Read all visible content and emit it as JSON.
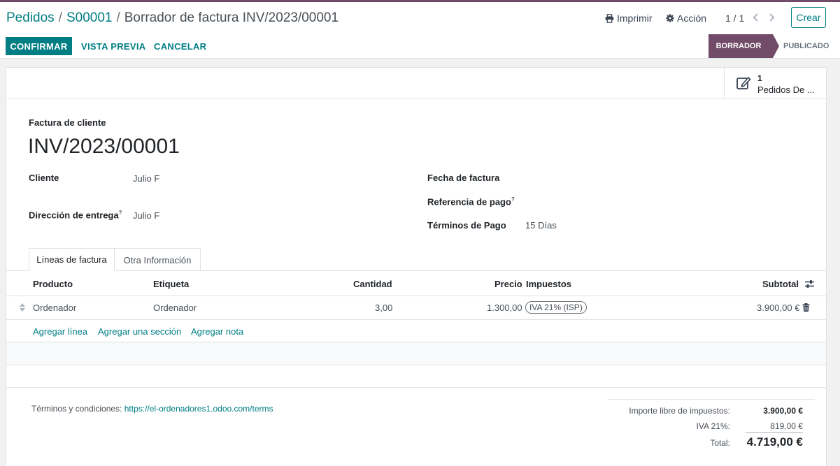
{
  "breadcrumb": {
    "root": "Pedidos",
    "order": "S00001",
    "current": "Borrador de factura INV/2023/00001"
  },
  "toolbar": {
    "print": "Imprimir",
    "action": "Acción",
    "pager": "1 / 1",
    "create": "Crear"
  },
  "statusbar": {
    "confirm": "CONFIRMAR",
    "preview": "VISTA PREVIA",
    "cancel": "CANCELAR",
    "stages": [
      "BORRADOR",
      "PUBLICADO"
    ],
    "active_stage": "BORRADOR"
  },
  "smart_button": {
    "value": "1",
    "label": "Pedidos De ..."
  },
  "form": {
    "type_label": "Factura de cliente",
    "number": "INV/2023/00001",
    "customer_label": "Cliente",
    "customer": "Julio F",
    "delivery_label": "Dirección de entrega",
    "delivery": "Julio F",
    "invoice_date_label": "Fecha de factura",
    "invoice_date": "",
    "payment_ref_label": "Referencia de pago",
    "payment_ref": "",
    "payment_terms_label": "Términos de Pago",
    "payment_terms": "15 Días",
    "help_mark": "?"
  },
  "tabs": [
    "Líneas de factura",
    "Otra Información"
  ],
  "lines": {
    "headers": {
      "product": "Producto",
      "label": "Etiqueta",
      "quantity": "Cantidad",
      "price": "Precio",
      "taxes": "Impuestos",
      "subtotal": "Subtotal"
    },
    "rows": [
      {
        "product": "Ordenador",
        "label": "Ordenador",
        "quantity": "3,00",
        "price": "1.300,00",
        "taxes": "IVA 21% (ISP)",
        "subtotal": "3.900,00 €"
      }
    ],
    "add_line": "Agregar línea",
    "add_section": "Agregar una sección",
    "add_note": "Agregar nota"
  },
  "footer": {
    "terms_label": "Términos y condiciones:",
    "terms_url": "https://el-ordenadores1.odoo.com/terms",
    "untaxed_label": "Importe libre de impuestos:",
    "untaxed": "3.900,00 €",
    "tax_label": "IVA 21%:",
    "tax": "819,00 €",
    "total_label": "Total:",
    "total": "4.719,00 €"
  },
  "colors": {
    "brand": "#714b67",
    "accent": "#017e84"
  },
  "icons": [
    "printer-icon",
    "gear-icon",
    "chevron-left-icon",
    "chevron-right-icon",
    "edit-icon",
    "sort-handle-icon",
    "column-settings-icon",
    "trash-icon"
  ]
}
